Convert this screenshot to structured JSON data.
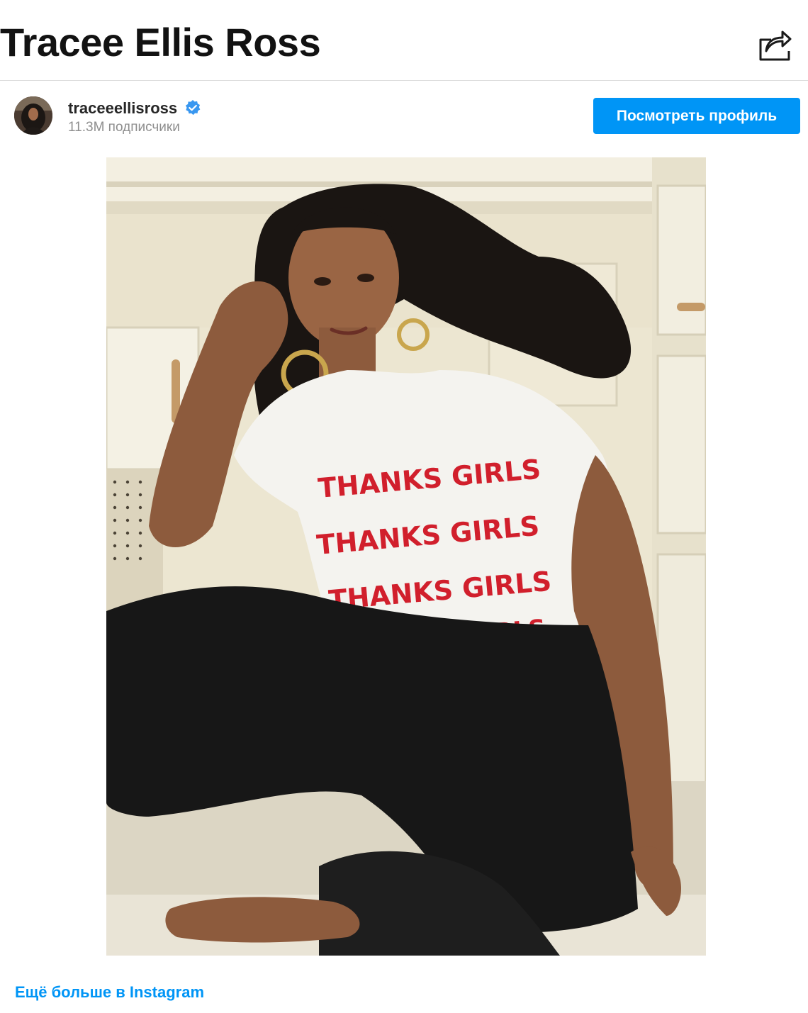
{
  "header": {
    "title": "Tracee Ellis Ross",
    "share_icon": "share-arrow-icon"
  },
  "profile": {
    "username": "traceeellisross",
    "verified_icon": "verified-badge-icon",
    "followers": "11.3M подписчики",
    "view_profile_label": "Посмотреть профиль"
  },
  "post": {
    "shirt_lines": [
      "THANKS GIRLS",
      "THANKS GIRLS",
      "THANKS GIRLS",
      "THANKS GIRLS"
    ]
  },
  "footer": {
    "more_link": "Ещё больше в Instagram"
  },
  "colors": {
    "accent": "#0095f6",
    "title": "#121212",
    "muted": "#8e8e8e",
    "shirt_print": "#d11f2c"
  }
}
